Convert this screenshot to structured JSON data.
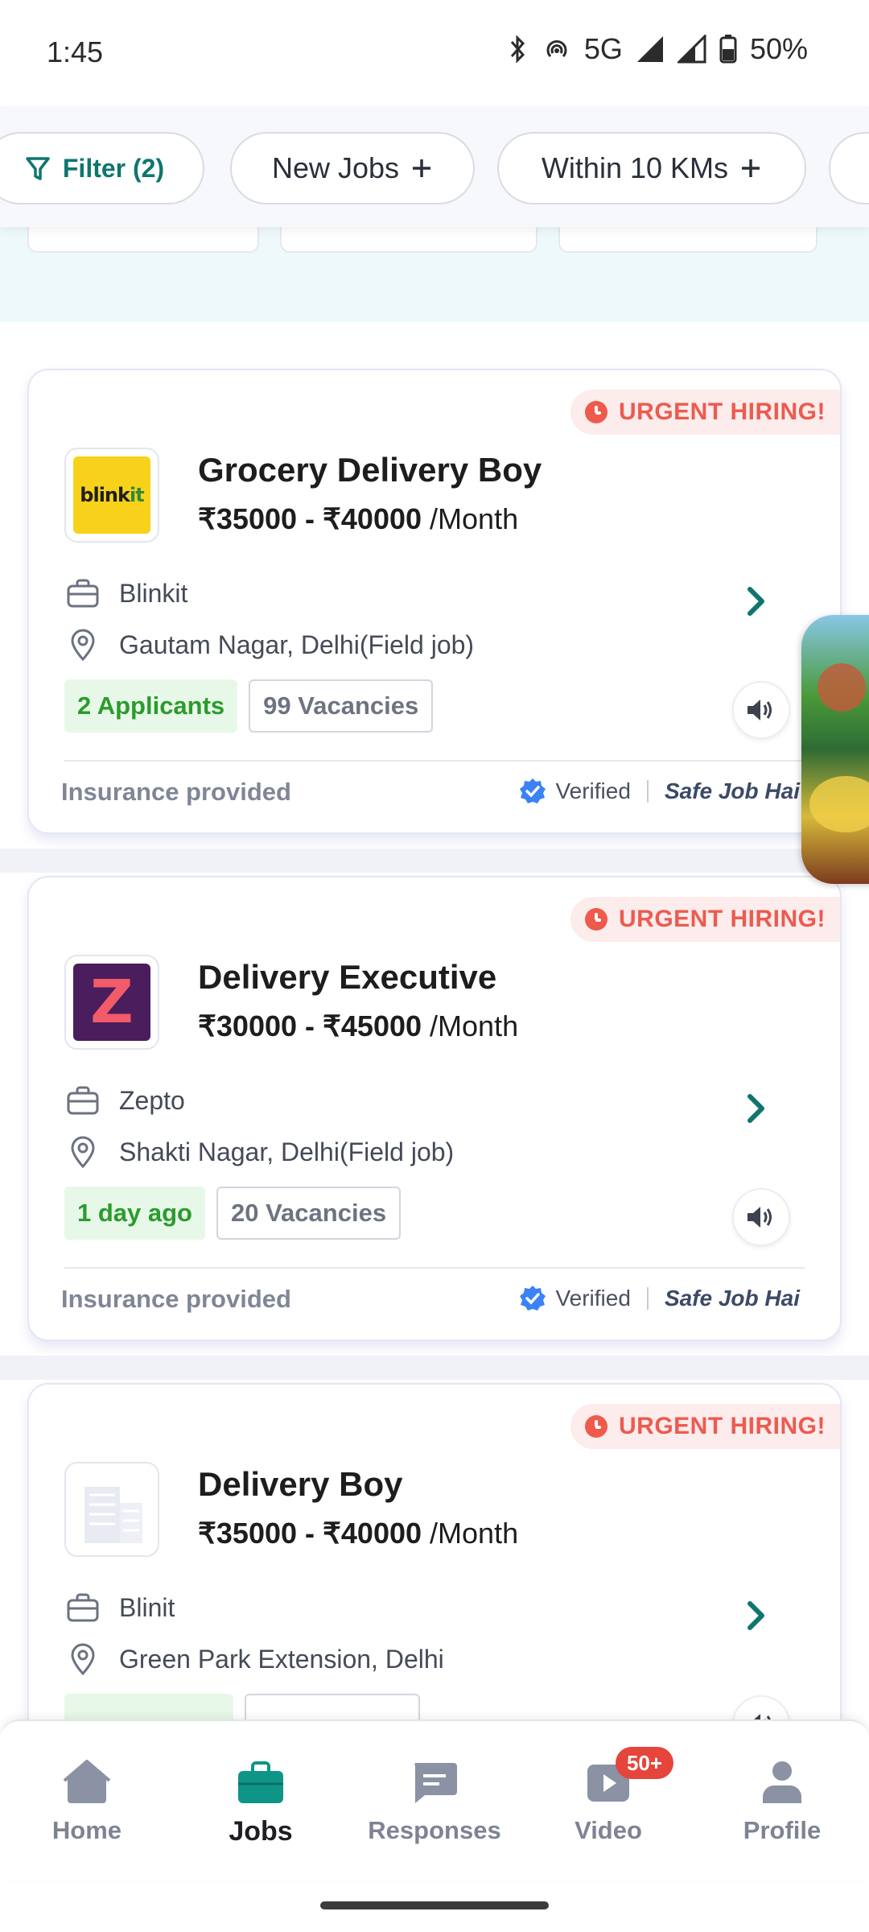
{
  "status_bar": {
    "time": "1:45",
    "network": "5G",
    "battery": "50%"
  },
  "filters": {
    "filter_label": "Filter (2)",
    "chips": [
      {
        "label": "New Jobs"
      },
      {
        "label": "Within 10 KMs"
      }
    ]
  },
  "jobs": [
    {
      "urgent": "URGENT HIRING!",
      "title": "Grocery Delivery Boy",
      "salary": "₹35000 - ₹40000",
      "period": "/Month",
      "company": "Blinkit",
      "location": "Gautam Nagar, Delhi(Field job)",
      "badge_primary": "2 Applicants",
      "badge_secondary": "99 Vacancies",
      "footer_left": "Insurance provided",
      "verified": "Verified",
      "safe": "Safe Job Hai",
      "logo_text": "blinkit"
    },
    {
      "urgent": "URGENT HIRING!",
      "title": "Delivery Executive",
      "salary": "₹30000 - ₹45000",
      "period": "/Month",
      "company": "Zepto",
      "location": "Shakti Nagar, Delhi(Field job)",
      "badge_primary": "1 day ago",
      "badge_secondary": "20 Vacancies",
      "footer_left": "Insurance provided",
      "verified": "Verified",
      "safe": "Safe Job Hai",
      "logo_text": "Z"
    },
    {
      "urgent": "URGENT HIRING!",
      "title": "Delivery Boy",
      "salary": "₹35000 - ₹40000",
      "period": "/Month",
      "company": "Blinit",
      "location": "Green Park Extension, Delhi"
    }
  ],
  "bottom_nav": [
    {
      "label": "Home",
      "icon": "home-icon"
    },
    {
      "label": "Jobs",
      "icon": "briefcase-icon",
      "active": true
    },
    {
      "label": "Responses",
      "icon": "chat-icon"
    },
    {
      "label": "Video",
      "icon": "video-icon",
      "badge": "50+"
    },
    {
      "label": "Profile",
      "icon": "person-icon"
    }
  ],
  "colors": {
    "accent": "#0f766e",
    "urgent": "#ec5b4f",
    "green": "#2b9b2e"
  }
}
